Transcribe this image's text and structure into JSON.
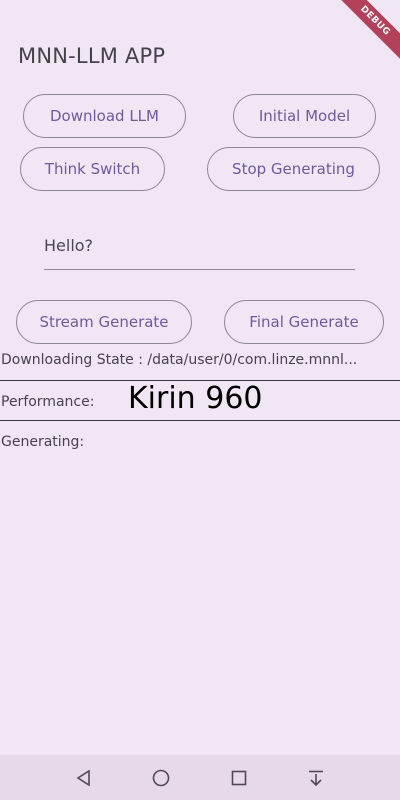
{
  "app": {
    "title": "MNN-LLM APP",
    "debug_label": "DEBUG"
  },
  "buttons": {
    "download": "Download LLM",
    "initial": "Initial Model",
    "think": "Think Switch",
    "stop": "Stop Generating",
    "stream": "Stream Generate",
    "final": "Final Generate"
  },
  "input": {
    "value": "Hello?"
  },
  "status": {
    "downloading": "Downloading State : /data/user/0/com.linze.mnnl...",
    "performance": "Performance:",
    "generating": "Generating:"
  },
  "overlay": {
    "device": "Kirin 960"
  },
  "nav": {
    "icons": [
      "back-icon",
      "home-icon",
      "recents-icon",
      "down-arrow-icon"
    ]
  },
  "colors": {
    "background": "#f1e6f4",
    "accent": "#6d5a9e",
    "debug_ribbon": "#b3415a"
  }
}
